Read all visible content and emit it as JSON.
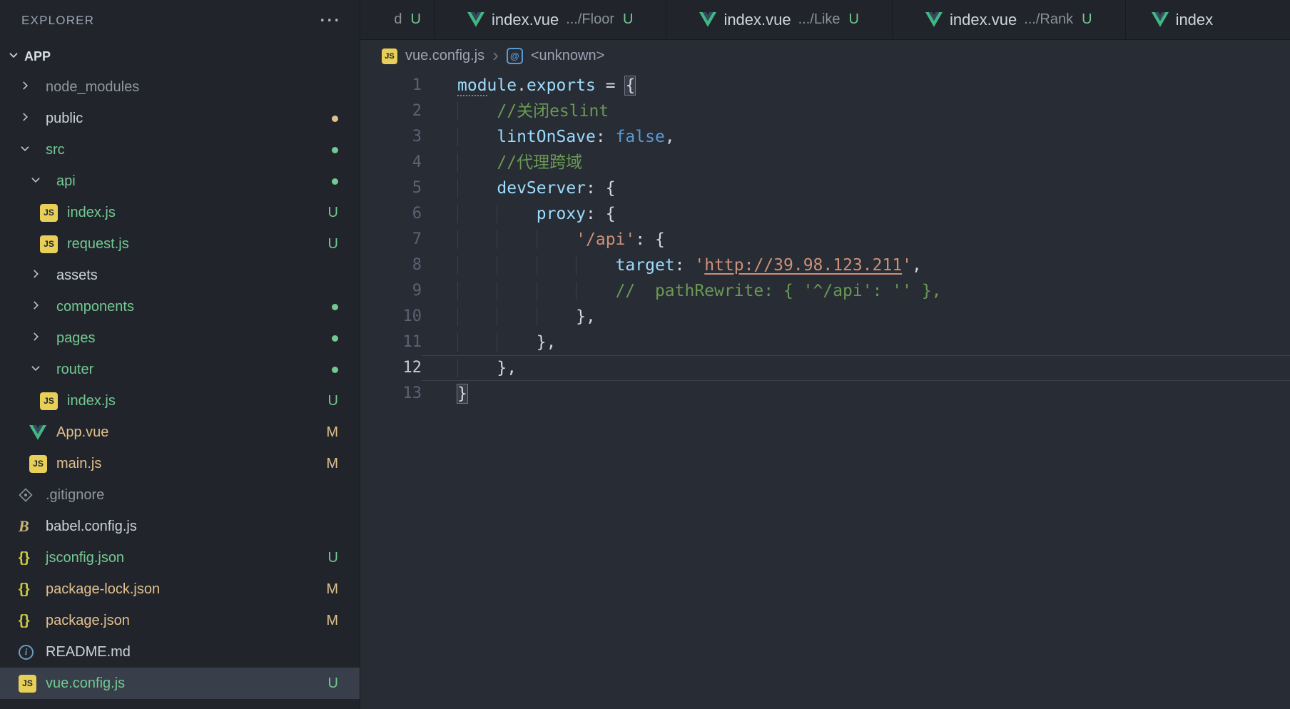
{
  "palette": {
    "editor_bg": "#282c34",
    "sidebar_bg": "#21252b",
    "tabbar_bg": "#21252b",
    "border_dark": "#181a1f",
    "selected_row_bg": "#383e4a",
    "text_normal": "#ccd2dc",
    "text_dim": "#8f969f",
    "git_untracked": "#73c991",
    "git_modified": "#e2c08d",
    "tok_fg": "#d4d8e0",
    "tok_prop": "#9cdcfe",
    "tok_keyword": "#569cd6",
    "tok_string": "#ce9178",
    "tok_comment": "#6a9955",
    "gutter": "#5a6375",
    "gutter_active": "#c5cdd9",
    "indent_guide": "#3b4049",
    "current_line_border": "#3a404c",
    "icon_js_bg": "#e7cf58",
    "icon_vue_green": "#41b883",
    "icon_vue_dark": "#35495e",
    "icon_json": "#cbcb41",
    "icon_info": "#6d9cbe",
    "icon_babel": "#c9b674",
    "icon_git": "#8a919b",
    "chevron": "#b9bfc9",
    "breadcrumb_fg": "#9da5b4",
    "symbol_icon": "#5a9bd3"
  },
  "explorer": {
    "title": "EXPLORER",
    "more_actions": "⋯",
    "section": "APP",
    "items": [
      {
        "label": "node_modules",
        "kind": "folder",
        "chevron": "right",
        "level": 1,
        "tint": "dim"
      },
      {
        "label": "public",
        "kind": "folder",
        "chevron": "right",
        "level": 1,
        "tint": "normal",
        "badge_dot": "modified"
      },
      {
        "label": "src",
        "kind": "folder",
        "chevron": "down",
        "level": 1,
        "tint": "untracked",
        "badge_dot": "untracked"
      },
      {
        "label": "api",
        "kind": "folder",
        "chevron": "down",
        "level": 2,
        "tint": "untracked",
        "badge_dot": "untracked"
      },
      {
        "label": "index.js",
        "kind": "js",
        "level": 3,
        "tint": "untracked",
        "git": "U"
      },
      {
        "label": "request.js",
        "kind": "js",
        "level": 3,
        "tint": "untracked",
        "git": "U"
      },
      {
        "label": "assets",
        "kind": "folder",
        "chevron": "right",
        "level": 2,
        "tint": "normal"
      },
      {
        "label": "components",
        "kind": "folder",
        "chevron": "right",
        "level": 2,
        "tint": "untracked",
        "badge_dot": "untracked"
      },
      {
        "label": "pages",
        "kind": "folder",
        "chevron": "right",
        "level": 2,
        "tint": "untracked",
        "badge_dot": "untracked"
      },
      {
        "label": "router",
        "kind": "folder",
        "chevron": "down",
        "level": 2,
        "tint": "untracked",
        "badge_dot": "untracked"
      },
      {
        "label": "index.js",
        "kind": "js",
        "level": 3,
        "tint": "untracked",
        "git": "U"
      },
      {
        "label": "App.vue",
        "kind": "vue",
        "level": 2,
        "tint": "modified",
        "git": "M"
      },
      {
        "label": "main.js",
        "kind": "js",
        "level": 2,
        "tint": "modified",
        "git": "M"
      },
      {
        "label": ".gitignore",
        "kind": "git",
        "level": 1,
        "tint": "dim"
      },
      {
        "label": "babel.config.js",
        "kind": "babel",
        "level": 1,
        "tint": "normal"
      },
      {
        "label": "jsconfig.json",
        "kind": "json",
        "level": 1,
        "tint": "untracked",
        "git": "U"
      },
      {
        "label": "package-lock.json",
        "kind": "json",
        "level": 1,
        "tint": "modified",
        "git": "M"
      },
      {
        "label": "package.json",
        "kind": "json",
        "level": 1,
        "tint": "modified",
        "git": "M"
      },
      {
        "label": "README.md",
        "kind": "info",
        "level": 1,
        "tint": "normal"
      },
      {
        "label": "vue.config.js",
        "kind": "js",
        "level": 1,
        "tint": "untracked",
        "git": "U",
        "selected": true
      }
    ]
  },
  "tabs": [
    {
      "partial": "left",
      "desc_fragment": "d",
      "git": "U"
    },
    {
      "icon": "vue",
      "name": "index.vue",
      "desc": ".../Floor",
      "git": "U"
    },
    {
      "icon": "vue",
      "name": "index.vue",
      "desc": ".../Like",
      "git": "U"
    },
    {
      "icon": "vue",
      "name": "index.vue",
      "desc": ".../Rank",
      "git": "U"
    },
    {
      "partial": "right",
      "icon": "vue",
      "name": "index"
    }
  ],
  "breadcrumb": {
    "file": "vue.config.js",
    "symbol": "<unknown>"
  },
  "editor": {
    "lines": [
      {
        "num": 1,
        "indent": 0,
        "segments": [
          {
            "t": "mod",
            "c": "prop",
            "dots": true
          },
          {
            "t": "ule",
            "c": "prop"
          },
          {
            "t": ".",
            "c": "fg"
          },
          {
            "t": "exports",
            "c": "prop"
          },
          {
            "t": " = ",
            "c": "fg"
          },
          {
            "t": "{",
            "c": "fg",
            "match": true
          }
        ]
      },
      {
        "num": 2,
        "indent": 4,
        "segments": [
          {
            "t": "//关闭eslint",
            "c": "comment"
          }
        ]
      },
      {
        "num": 3,
        "indent": 4,
        "segments": [
          {
            "t": "lintOnSave",
            "c": "prop"
          },
          {
            "t": ": ",
            "c": "fg"
          },
          {
            "t": "false",
            "c": "keyword"
          },
          {
            "t": ",",
            "c": "fg"
          }
        ]
      },
      {
        "num": 4,
        "indent": 4,
        "segments": [
          {
            "t": "//代理跨域",
            "c": "comment"
          }
        ]
      },
      {
        "num": 5,
        "indent": 4,
        "segments": [
          {
            "t": "devServer",
            "c": "prop"
          },
          {
            "t": ": ",
            "c": "fg"
          },
          {
            "t": "{",
            "c": "fg"
          }
        ]
      },
      {
        "num": 6,
        "indent": 8,
        "segments": [
          {
            "t": "proxy",
            "c": "prop"
          },
          {
            "t": ": ",
            "c": "fg"
          },
          {
            "t": "{",
            "c": "fg"
          }
        ]
      },
      {
        "num": 7,
        "indent": 12,
        "segments": [
          {
            "t": "'/api'",
            "c": "string"
          },
          {
            "t": ": ",
            "c": "fg"
          },
          {
            "t": "{",
            "c": "fg"
          }
        ]
      },
      {
        "num": 8,
        "indent": 16,
        "segments": [
          {
            "t": "target",
            "c": "prop"
          },
          {
            "t": ": ",
            "c": "fg"
          },
          {
            "t": "'",
            "c": "string"
          },
          {
            "t": "http://39.98.123.211",
            "c": "string",
            "underline": true
          },
          {
            "t": "'",
            "c": "string"
          },
          {
            "t": ",",
            "c": "fg"
          }
        ]
      },
      {
        "num": 9,
        "indent": 16,
        "segments": [
          {
            "t": "//  pathRewrite: { '^/api': '' },",
            "c": "comment"
          }
        ]
      },
      {
        "num": 10,
        "indent": 12,
        "segments": [
          {
            "t": "},",
            "c": "fg"
          }
        ]
      },
      {
        "num": 11,
        "indent": 8,
        "segments": [
          {
            "t": "},",
            "c": "fg"
          }
        ]
      },
      {
        "num": 12,
        "indent": 4,
        "segments": [
          {
            "t": "},",
            "c": "fg"
          }
        ],
        "current": true
      },
      {
        "num": 13,
        "indent": 0,
        "segments": [
          {
            "t": "}",
            "c": "fg",
            "match": true
          }
        ]
      }
    ]
  }
}
